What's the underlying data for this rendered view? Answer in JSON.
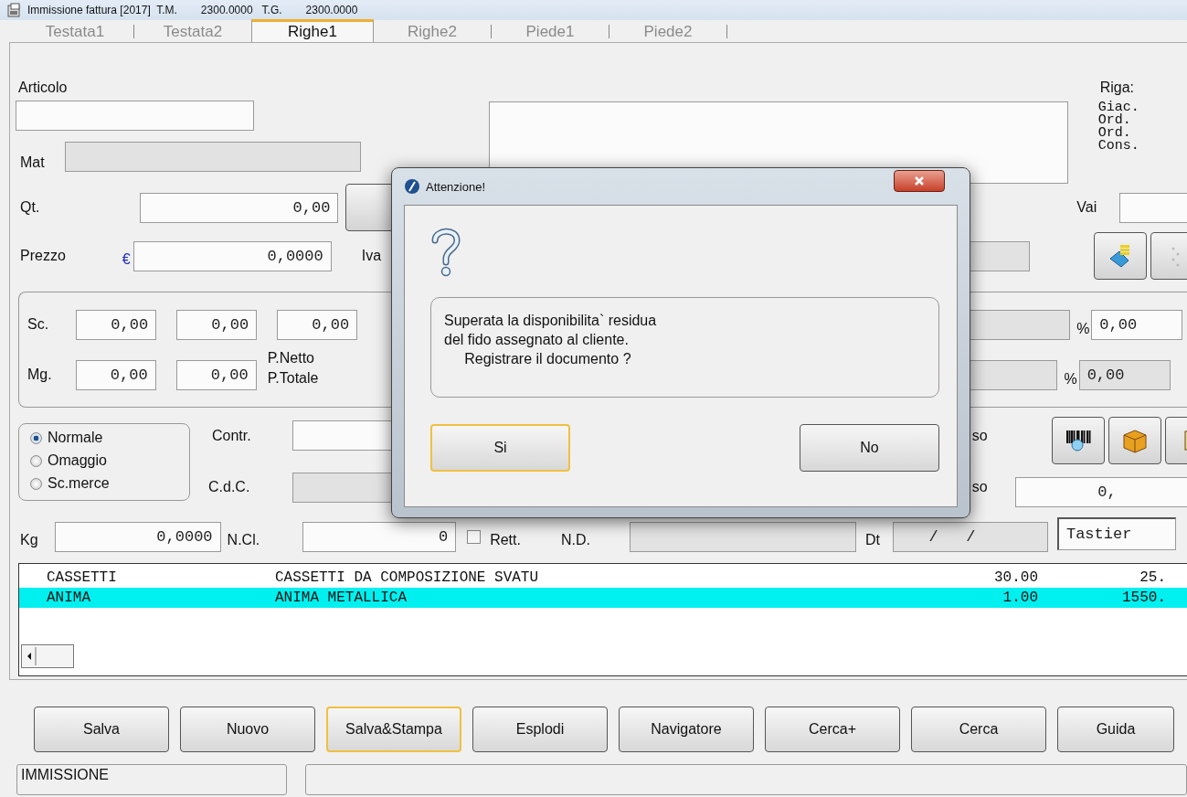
{
  "window": {
    "title": "Immissione fattura [2017]  T.M.",
    "tm_value": "2300.0000",
    "tg_label": "T.G.",
    "tg_value": "2300.0000"
  },
  "tabs": [
    {
      "label": "Testata1",
      "selected": false
    },
    {
      "label": "Testata2",
      "selected": false
    },
    {
      "label": "Righe1",
      "selected": true
    },
    {
      "label": "Righe2",
      "selected": false
    },
    {
      "label": "Piede1",
      "selected": false
    },
    {
      "label": "Piede2",
      "selected": false
    }
  ],
  "form": {
    "article_label": "Articolo",
    "row_info": {
      "label": "Riga:",
      "lines": [
        "Giac.",
        "Ord.",
        "Ord.",
        "Cons."
      ]
    },
    "mat_label": "Mat",
    "qty": {
      "label": "Qt.",
      "value": "0,00"
    },
    "goto_label": "Vai",
    "price": {
      "label": "Prezzo",
      "currency": "€",
      "value": "0,0000"
    },
    "vat_label": "Iva",
    "discounts": {
      "label": "Sc.",
      "values": [
        "0,00",
        "0,00",
        "0,00"
      ]
    },
    "margins": {
      "label": "Mg.",
      "values": [
        "0,00",
        "0,00"
      ]
    },
    "net_price_label": "P.Netto",
    "total_price_label": "P.Totale",
    "percent_fields": [
      {
        "sign": "%",
        "value": "0,00",
        "disabled": false
      },
      {
        "sign": "%",
        "value": "0,00",
        "disabled": true
      }
    ],
    "line_types": [
      {
        "label": "Normale",
        "selected": true
      },
      {
        "label": "Omaggio",
        "selected": false
      },
      {
        "label": "Sc.merce",
        "selected": false
      }
    ],
    "contract_label": "Contr.",
    "cost_center_label": "C.d.C.",
    "cut_labels": [
      "so",
      "so"
    ],
    "cut_value": "0,",
    "weight": {
      "label": "Kg",
      "value": "0,0000"
    },
    "packages": {
      "label": "N.Cl.",
      "value": "0"
    },
    "adjust": {
      "label": "Rett.",
      "checked": false
    },
    "nd_label": "N.D.",
    "date": {
      "label": "Dt",
      "value": "/   /"
    },
    "input_mode": "Tastier"
  },
  "lines": [
    {
      "code": "CASSETTI",
      "description": "CASSETTI DA COMPOSIZIONE SVATU",
      "qty": "30.00",
      "price": "25.",
      "selected": false
    },
    {
      "code": "ANIMA",
      "description": "ANIMA METALLICA",
      "qty": "1.00",
      "price": "1550.",
      "selected": true
    }
  ],
  "buttons": [
    {
      "label": "Salva",
      "focused": false
    },
    {
      "label": "Nuovo",
      "focused": false
    },
    {
      "label": "Salva&Stampa",
      "focused": true
    },
    {
      "label": "Esplodi",
      "focused": false
    },
    {
      "label": "Navigatore",
      "focused": false
    },
    {
      "label": "Cerca+",
      "focused": false
    },
    {
      "label": "Cerca",
      "focused": false
    },
    {
      "label": "Guida",
      "focused": false
    }
  ],
  "status_bar": {
    "mode": "IMMISSIONE"
  },
  "dialog": {
    "title": "Attenzione!",
    "message": "Superata la disponibilita` residua\ndel fido assegnato al cliente.\n     Registrare il documento ?",
    "buttons": [
      {
        "label": "Si",
        "focused": true
      },
      {
        "label": "No",
        "focused": false
      }
    ]
  }
}
